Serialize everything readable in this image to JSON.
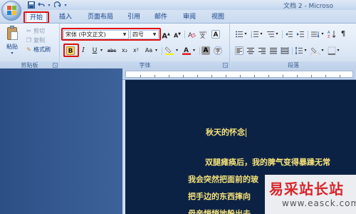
{
  "window": {
    "title": "文档 2 - Microso"
  },
  "quick_access": {
    "save_icon": "save-icon",
    "undo_icon": "undo-icon",
    "redo_icon": "redo-icon"
  },
  "tabs": [
    {
      "label": "开始",
      "active": true
    },
    {
      "label": "插入"
    },
    {
      "label": "页面布局"
    },
    {
      "label": "引用"
    },
    {
      "label": "邮件"
    },
    {
      "label": "审阅"
    },
    {
      "label": "视图"
    }
  ],
  "clipboard": {
    "paste_label": "粘贴",
    "cut_label": "剪切",
    "copy_label": "复制",
    "format_painter_label": "格式刷",
    "group_label": "剪贴板"
  },
  "font": {
    "font_name": "宋体 (中文正文)",
    "font_size": "四号",
    "grow_label": "A",
    "shrink_label": "A",
    "clear_label": "A",
    "bold_label": "B",
    "italic_label": "I",
    "underline_label": "U",
    "strike_label": "abc",
    "subscript_label": "x₂",
    "superscript_label": "x²",
    "case_label": "Aa",
    "highlight_label": "ab",
    "font_color_label": "A",
    "char_shade_label": "A",
    "enclose_label": "字",
    "group_label": "字体"
  },
  "paragraph": {
    "group_label": "段落"
  },
  "document": {
    "title": "秋天的怀念",
    "lines": [
      "双腿瘫痪后，我的脾气变得暴躁无常",
      "我会突然把面前的玻",
      "把手边的东西摔向",
      "母亲悄悄地躲出去"
    ]
  },
  "watermark": {
    "title": "易采站长站",
    "url": "www.easck.com"
  },
  "colors": {
    "highlight_red": "#e01010",
    "page_background": "#0c2244",
    "text_yellow": "#f6e27a",
    "ribbon_blue": "#15428b"
  }
}
